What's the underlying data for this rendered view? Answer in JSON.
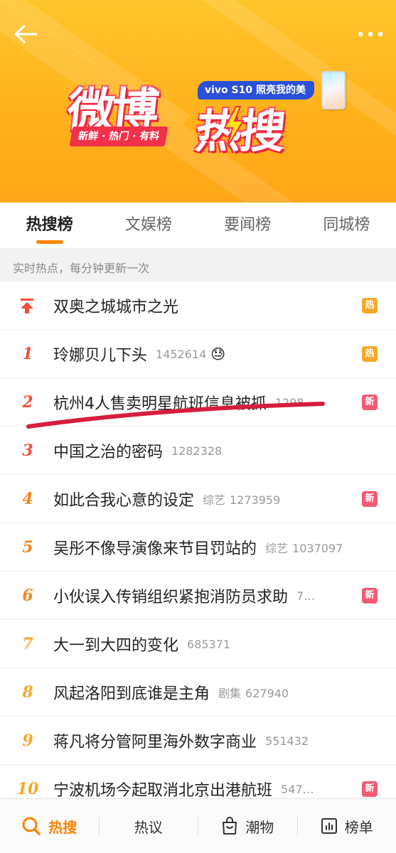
{
  "header": {
    "back_icon": "back-arrow-icon",
    "more_icon": "more-dots-icon",
    "logo_weibo": "微博",
    "logo_resou": "热搜",
    "logo_tagline": "新鲜 · 热门 · 有料",
    "sponsor": "vivo S10 照亮我的美"
  },
  "tabs": [
    {
      "label": "热搜榜",
      "active": true
    },
    {
      "label": "文娱榜",
      "active": false
    },
    {
      "label": "要闻榜",
      "active": false
    },
    {
      "label": "同城榜",
      "active": false
    }
  ],
  "subhead": "实时热点，每分钟更新一次",
  "items": [
    {
      "rank": "",
      "pinned": true,
      "title": "双奥之城城市之光",
      "category": "",
      "count": "",
      "emoji": "",
      "badge": "热"
    },
    {
      "rank": "1",
      "title": "玲娜贝儿下头",
      "category": "",
      "count": "1452614",
      "emoji": "😓",
      "badge": "热"
    },
    {
      "rank": "2",
      "title": "杭州4人售卖明星航班信息被抓",
      "category": "",
      "count": "1298…",
      "emoji": "",
      "badge": "新"
    },
    {
      "rank": "3",
      "title": "中国之治的密码",
      "category": "",
      "count": "1282328",
      "emoji": "",
      "badge": ""
    },
    {
      "rank": "4",
      "title": "如此合我心意的设定",
      "category": "综艺",
      "count": "1273959",
      "emoji": "",
      "badge": "新"
    },
    {
      "rank": "5",
      "title": "吴彤不像导演像来节目罚站的",
      "category": "综艺",
      "count": "1037097",
      "emoji": "",
      "badge": ""
    },
    {
      "rank": "6",
      "title": "小伙误入传销组织紧抱消防员求助",
      "category": "",
      "count": "7…",
      "emoji": "",
      "badge": "新"
    },
    {
      "rank": "7",
      "title": "大一到大四的变化",
      "category": "",
      "count": "685371",
      "emoji": "",
      "badge": ""
    },
    {
      "rank": "8",
      "title": "风起洛阳到底谁是主角",
      "category": "剧集",
      "count": "627940",
      "emoji": "",
      "badge": ""
    },
    {
      "rank": "9",
      "title": "蒋凡将分管阿里海外数字商业",
      "category": "",
      "count": "551432",
      "emoji": "",
      "badge": ""
    },
    {
      "rank": "10",
      "title": "宁波机场今起取消北京出港航班",
      "category": "",
      "count": "547…",
      "emoji": "",
      "badge": "新"
    }
  ],
  "bottom_nav": [
    {
      "label": "热搜",
      "icon": "search-icon",
      "active": true
    },
    {
      "label": "热议",
      "icon": "",
      "active": false
    },
    {
      "label": "潮物",
      "icon": "shopping-bag-icon",
      "active": false
    },
    {
      "label": "榜单",
      "icon": "chart-icon",
      "active": false
    }
  ],
  "colors": {
    "accent": "#ff8200",
    "rank_top": "#f24e3a",
    "badge_hot": "#f7a829",
    "badge_new": "#f25a72",
    "annotation": "#d61e3c"
  }
}
